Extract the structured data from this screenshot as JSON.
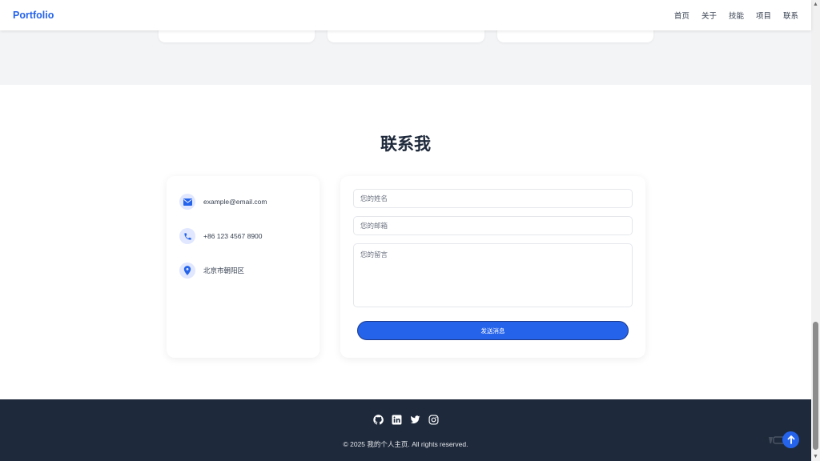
{
  "header": {
    "brand": "Portfolio",
    "nav": [
      "首页",
      "关于",
      "技能",
      "项目",
      "联系"
    ]
  },
  "contact": {
    "title": "联系我",
    "info": {
      "email": "example@email.com",
      "phone": "+86 123 4567 8900",
      "location": "北京市朝阳区"
    },
    "form": {
      "name_placeholder": "您的姓名",
      "email_placeholder": "您的邮箱",
      "message_placeholder": "您的留言",
      "submit_label": "发送消息"
    }
  },
  "footer": {
    "social_icons": [
      "github-icon",
      "linkedin-icon",
      "twitter-icon",
      "instagram-icon"
    ],
    "copyright": "© 2025 我的个人主页. All rights reserved."
  },
  "colors": {
    "accent": "#2563eb",
    "footer_bg": "#1e293b",
    "section_bg": "#f3f4f6"
  }
}
